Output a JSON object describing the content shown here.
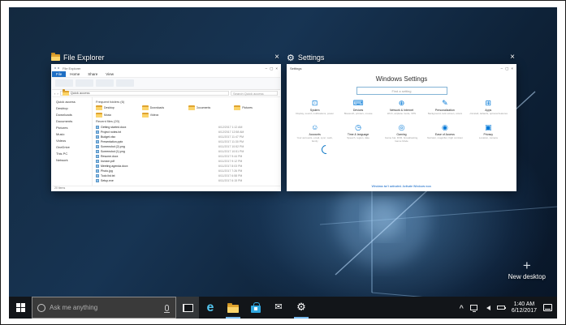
{
  "icons": {
    "close": "×",
    "plus": "+",
    "caret": "^",
    "min": "–",
    "max": "▢",
    "back": "‹",
    "fwd": "›",
    "edge": "e",
    "mail": "✉",
    "gear": "⚙"
  },
  "task_view": {
    "windows": [
      {
        "title": "File Explorer"
      },
      {
        "title": "Settings"
      }
    ],
    "new_desktop_label": "New desktop"
  },
  "taskbar": {
    "search_placeholder": "Ask me anything",
    "clock_time": "1:40 AM",
    "clock_date": "6/12/2017"
  },
  "file_explorer": {
    "caption": "File Explorer",
    "file_tab": "File",
    "ribbon_tabs": [
      "Home",
      "Share",
      "View"
    ],
    "address": "Quick access",
    "search_label": "Search Quick access",
    "nav": [
      "Quick access",
      "Desktop",
      "Downloads",
      "Documents",
      "Pictures",
      "Music",
      "Videos",
      "OneDrive",
      "This PC",
      "Network"
    ],
    "folders_section": "Frequent folders (6)",
    "files_section": "Recent files (20)",
    "folders": [
      "Desktop",
      "Downloads",
      "Documents",
      "Pictures",
      "Music",
      "Videos"
    ],
    "files": [
      {
        "name": "Getting started.docx",
        "date": "6/12/2017 1:12 AM"
      },
      {
        "name": "Project notes.txt",
        "date": "6/12/2017 12:58 AM"
      },
      {
        "name": "Budget.xlsx",
        "date": "6/11/2017 11:47 PM"
      },
      {
        "name": "Presentation.pptx",
        "date": "6/11/2017 11:30 PM"
      },
      {
        "name": "Screenshot (2).png",
        "date": "6/11/2017 10:52 PM"
      },
      {
        "name": "Screenshot (1).png",
        "date": "6/11/2017 10:51 PM"
      },
      {
        "name": "Resume.docx",
        "date": "6/11/2017 9:44 PM"
      },
      {
        "name": "Invoice.pdf",
        "date": "6/11/2017 9:12 PM"
      },
      {
        "name": "Meeting agenda.docx",
        "date": "6/11/2017 8:03 PM"
      },
      {
        "name": "Photo.jpg",
        "date": "6/11/2017 7:26 PM"
      },
      {
        "name": "Todo list.txt",
        "date": "6/11/2017 6:58 PM"
      },
      {
        "name": "Setup.exe",
        "date": "6/11/2017 6:15 PM"
      }
    ],
    "status": "20 items"
  },
  "settings": {
    "caption": "Settings",
    "heading": "Windows Settings",
    "search_placeholder": "Find a setting",
    "footer_link": "Windows isn't activated. Activate Windows now.",
    "categories": [
      {
        "name": "System",
        "desc": "Display, sound, notifications, power",
        "icon": "system"
      },
      {
        "name": "Devices",
        "desc": "Bluetooth, printers, mouse",
        "icon": "devices"
      },
      {
        "name": "Network & Internet",
        "desc": "Wi-Fi, airplane mode, VPN",
        "icon": "network"
      },
      {
        "name": "Personalization",
        "desc": "Background, lock screen, colors",
        "icon": "personalization"
      },
      {
        "name": "Apps",
        "desc": "Uninstall, defaults, optional features",
        "icon": "apps"
      },
      {
        "name": "Accounts",
        "desc": "Your accounts, email, sync, work, family",
        "icon": "accounts"
      },
      {
        "name": "Time & language",
        "desc": "Speech, region, date",
        "icon": "time"
      },
      {
        "name": "Gaming",
        "desc": "Game bar, DVR, broadcasting, Game Mode",
        "icon": "gaming"
      },
      {
        "name": "Ease of Access",
        "desc": "Narrator, magnifier, high contrast",
        "icon": "ease"
      },
      {
        "name": "Privacy",
        "desc": "Location, camera",
        "icon": "privacy"
      }
    ]
  }
}
